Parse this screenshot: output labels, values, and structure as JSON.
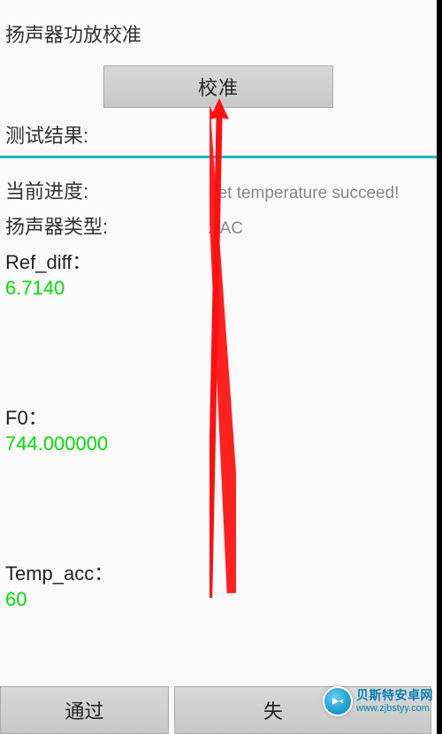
{
  "title": "扬声器功放校准",
  "calibrate_button_label": "校准",
  "test_result_label": "测试结果:",
  "progress": {
    "label": "当前进度:",
    "value": "get temperature succeed!"
  },
  "speaker_type": {
    "label": "扬声器类型:",
    "value": "AAC"
  },
  "ref_diff": {
    "label": "Ref_diff：",
    "value": "6.7140"
  },
  "f0": {
    "label": "F0：",
    "value": "744.000000"
  },
  "temp_acc": {
    "label": "Temp_acc：",
    "value": "60"
  },
  "footer": {
    "pass_label": "通过",
    "fail_label": "失"
  },
  "watermark": {
    "main": "贝斯特安卓网",
    "sub": "www.zjbstyy.com"
  }
}
